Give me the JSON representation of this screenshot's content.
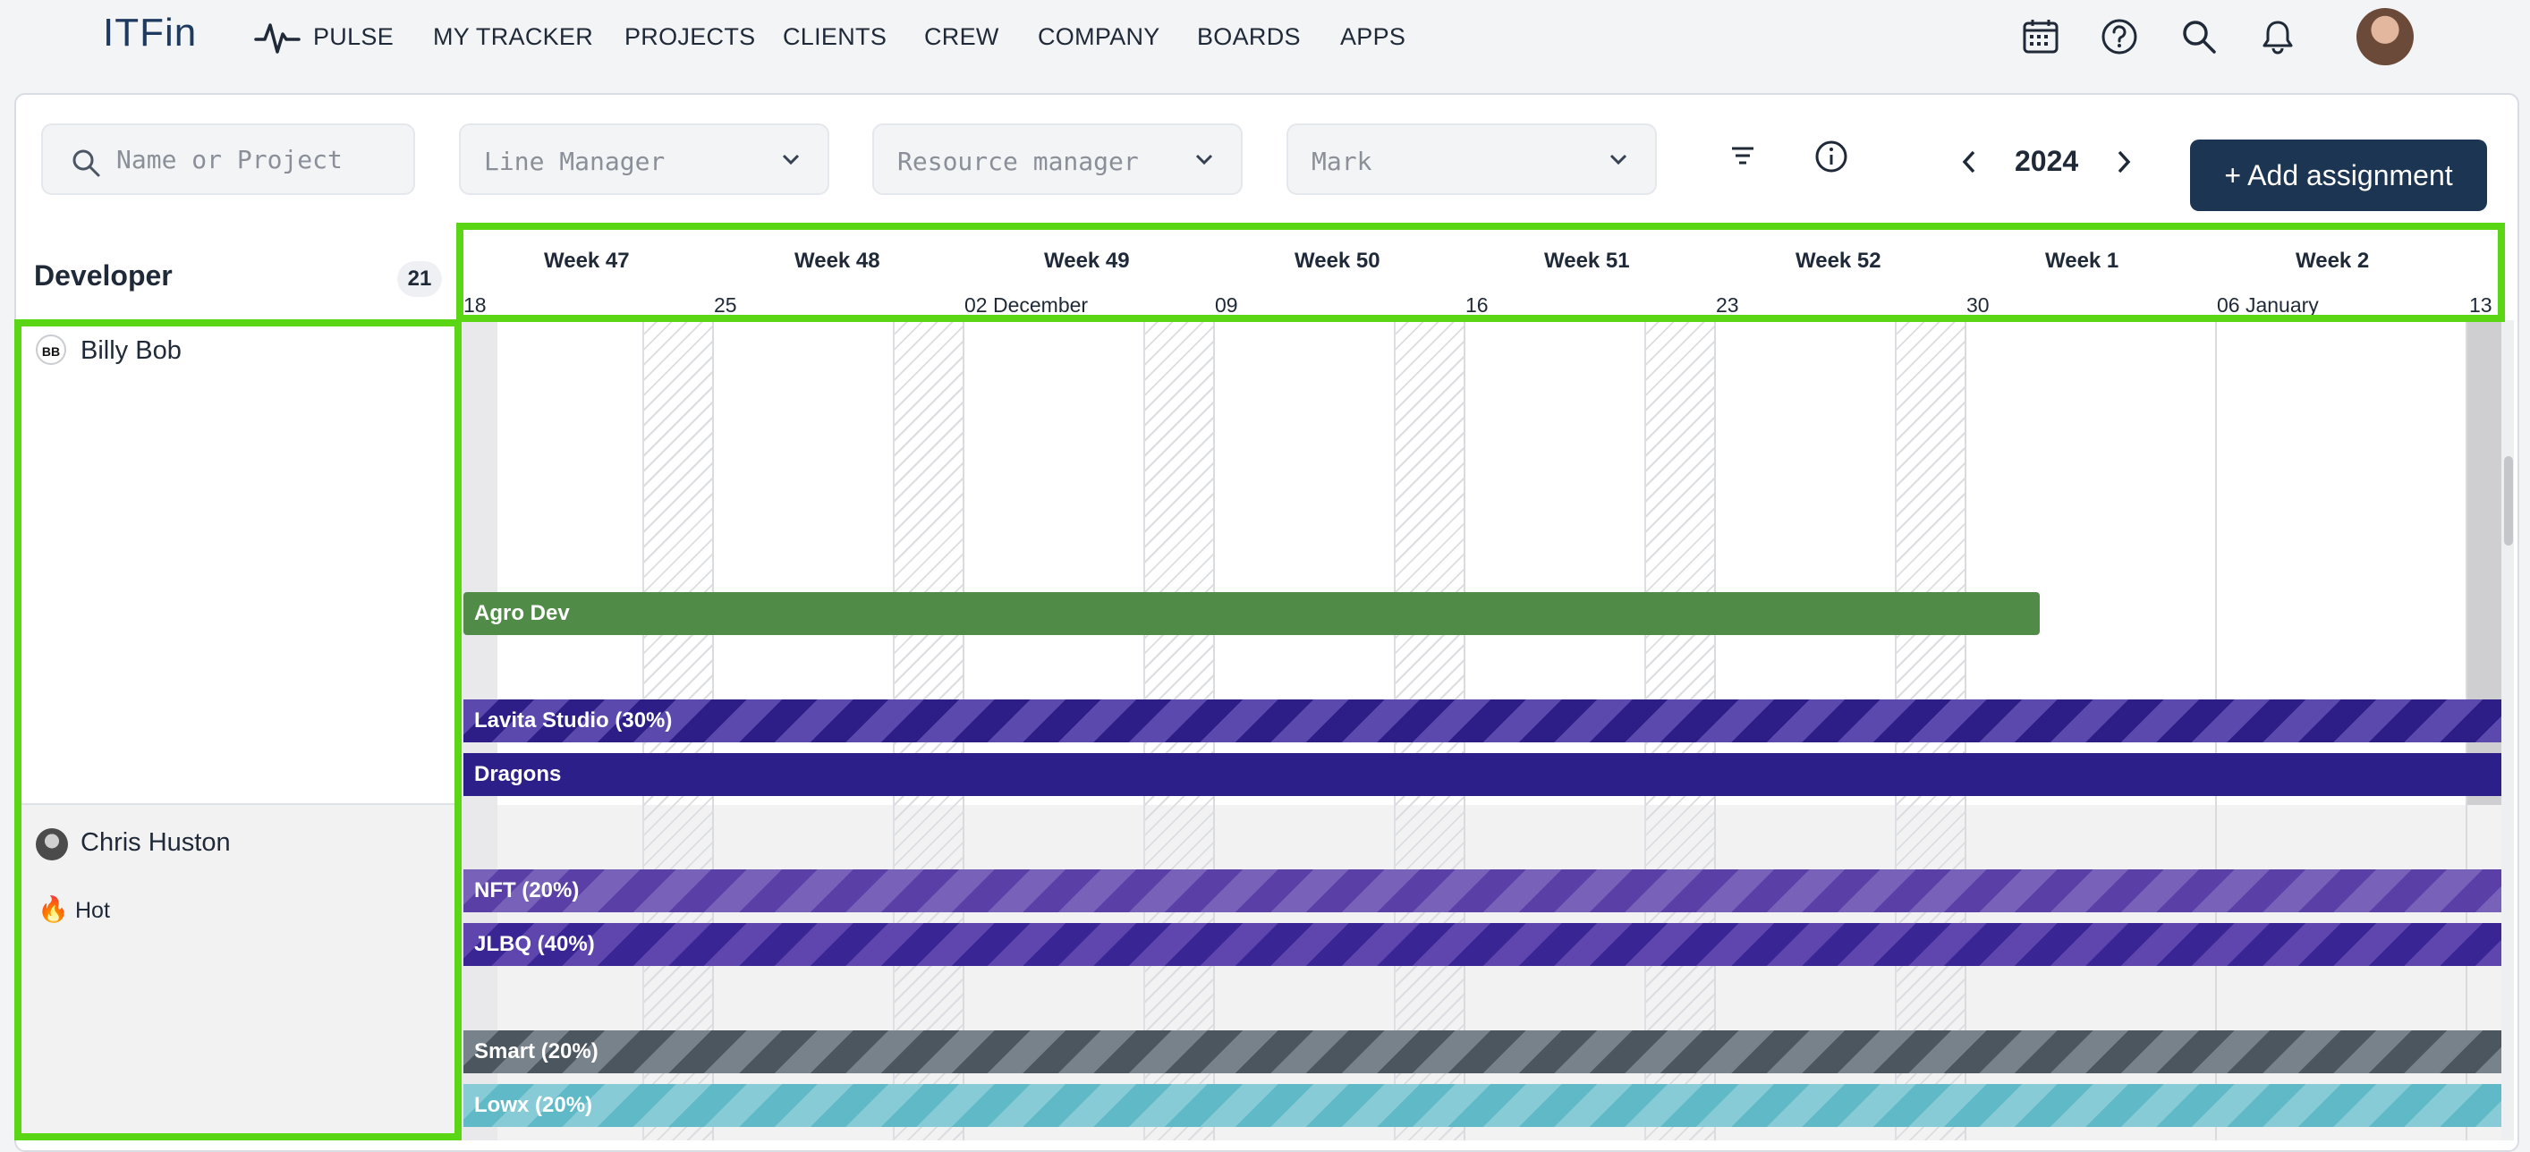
{
  "app": {
    "logo": "ITFin"
  },
  "nav": {
    "items": [
      {
        "id": "pulse",
        "label": "PULSE"
      },
      {
        "id": "my-tracker",
        "label": "MY TRACKER"
      },
      {
        "id": "projects",
        "label": "PROJECTS"
      },
      {
        "id": "clients",
        "label": "CLIENTS"
      },
      {
        "id": "crew",
        "label": "CREW"
      },
      {
        "id": "company",
        "label": "COMPANY"
      },
      {
        "id": "boards",
        "label": "BOARDS"
      },
      {
        "id": "apps",
        "label": "APPS"
      }
    ],
    "icons": [
      "calendar-icon",
      "help-icon",
      "search-icon",
      "bell-icon"
    ]
  },
  "filters": {
    "search_placeholder": "Name or Project",
    "line_manager": "Line Manager",
    "resource_manager": "Resource manager",
    "mark": "Mark"
  },
  "toolbar": {
    "year": "2024",
    "add_label": "+ Add assignment"
  },
  "developers": {
    "header": "Developer",
    "count": "21",
    "rows": [
      {
        "initials": "BB",
        "name": "Billy Bob"
      },
      {
        "name": "Chris Huston",
        "tag_icon": "🔥",
        "tag": "Hot"
      }
    ]
  },
  "timeline": {
    "weeks": [
      "Week 47",
      "Week 48",
      "Week 49",
      "Week 50",
      "Week 51",
      "Week 52",
      "Week 1",
      "Week 2"
    ],
    "dates": [
      "18",
      "25",
      "02 December",
      "09",
      "16",
      "23",
      "30",
      "06 January",
      "13"
    ]
  },
  "assignments": {
    "agro": "Agro Dev",
    "lavita": "Lavita Studio (30%)",
    "dragons": "Dragons",
    "nft": "NFT (20%)",
    "jlbq": "JLBQ (40%)",
    "smart": "Smart (20%)",
    "lowx": "Lowx (20%)"
  },
  "colors": {
    "accent_dark": "#1c3552",
    "agro": "#508b47",
    "dragons": "#2d1f89",
    "smart": "#4b565e",
    "lowx": "#5fb9c7",
    "highlight": "#5ad614"
  }
}
